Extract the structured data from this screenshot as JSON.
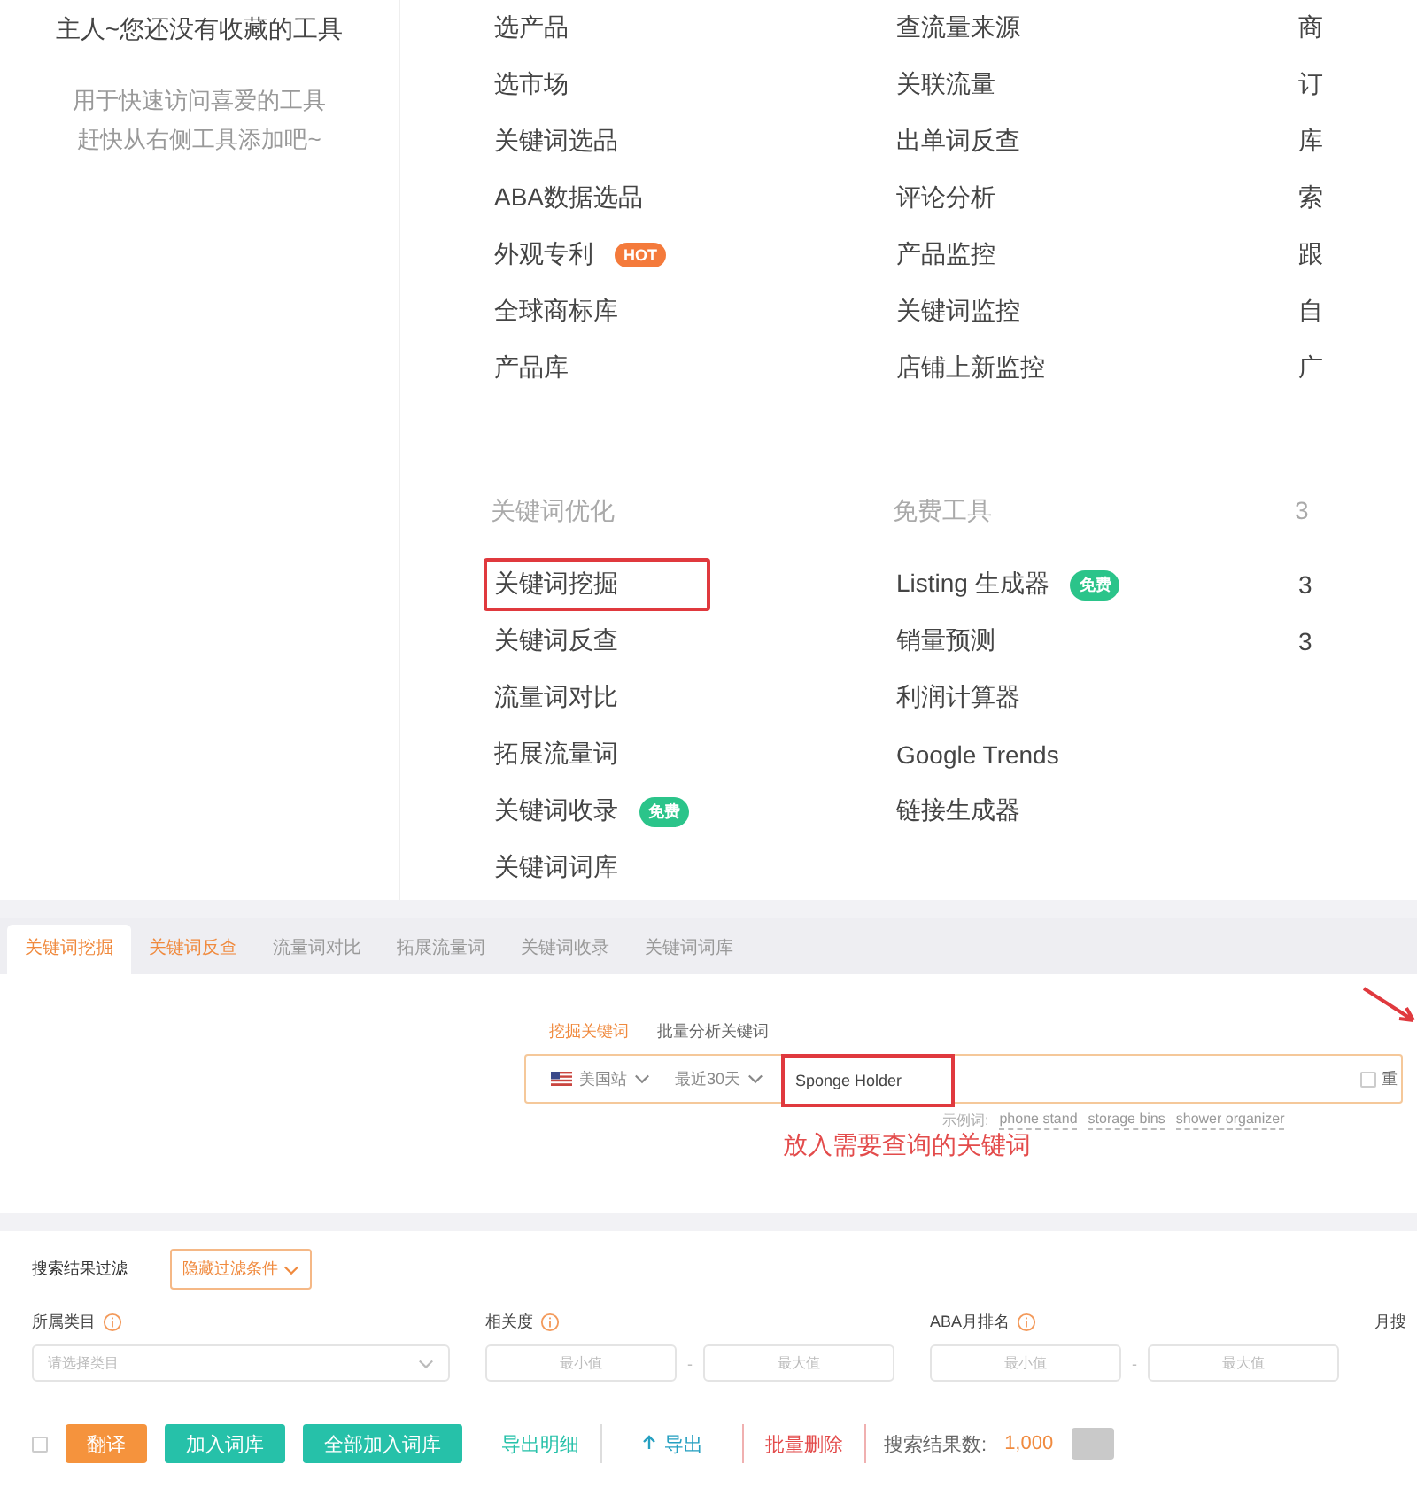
{
  "favorites": {
    "title": "主人~您还没有收藏的工具",
    "hint_lines": [
      "用于快速访问喜爱的工具",
      "赶快从右侧工具添加吧~"
    ]
  },
  "menu": {
    "columns": [
      {
        "groups": [
          {
            "items": [
              {
                "label": "选产品",
                "boxed": false
              },
              {
                "label": "选市场",
                "boxed": false
              },
              {
                "label": "关键词选品",
                "boxed": false
              },
              {
                "label": "ABA数据选品",
                "boxed": false
              },
              {
                "label": "外观专利",
                "boxed": false,
                "badge": {
                  "text": "HOT",
                  "kind": "hot"
                }
              },
              {
                "label": "全球商标库",
                "boxed": false
              },
              {
                "label": "产品库",
                "boxed": false
              }
            ]
          },
          {
            "header": "关键词优化",
            "items": [
              {
                "label": "关键词挖掘",
                "boxed": true
              },
              {
                "label": "关键词反查",
                "boxed": false
              },
              {
                "label": "流量词对比",
                "boxed": false
              },
              {
                "label": "拓展流量词",
                "boxed": false
              },
              {
                "label": "关键词收录",
                "boxed": false,
                "badge": {
                  "text": "免费",
                  "kind": "free"
                }
              },
              {
                "label": "关键词词库",
                "boxed": false
              }
            ]
          }
        ]
      },
      {
        "groups": [
          {
            "items": [
              {
                "label": "查流量来源",
                "boxed": false
              },
              {
                "label": "关联流量",
                "boxed": false
              },
              {
                "label": "出单词反查",
                "boxed": false
              },
              {
                "label": "评论分析",
                "boxed": false
              },
              {
                "label": "产品监控",
                "boxed": false
              },
              {
                "label": "关键词监控",
                "boxed": false
              },
              {
                "label": "店铺上新监控",
                "boxed": false
              }
            ]
          },
          {
            "header": "免费工具",
            "items": [
              {
                "label": "Listing 生成器",
                "boxed": false,
                "badge": {
                  "text": "免费",
                  "kind": "free"
                }
              },
              {
                "label": "销量预测",
                "boxed": false
              },
              {
                "label": "利润计算器",
                "boxed": false
              },
              {
                "label": "Google Trends",
                "boxed": false
              },
              {
                "label": "链接生成器",
                "boxed": false
              }
            ]
          }
        ]
      },
      {
        "groups": [
          {
            "items": [
              {
                "label": "商",
                "boxed": false
              },
              {
                "label": "订",
                "boxed": false
              },
              {
                "label": "库",
                "boxed": false
              },
              {
                "label": "索",
                "boxed": false
              },
              {
                "label": "跟",
                "boxed": false
              },
              {
                "label": "自",
                "boxed": false
              },
              {
                "label": "广",
                "boxed": false
              }
            ]
          },
          {
            "header": "3",
            "items": [
              {
                "label": "3",
                "boxed": false
              },
              {
                "label": "3",
                "boxed": false
              }
            ]
          }
        ]
      }
    ]
  },
  "tool_tabs": [
    {
      "label": "关键词挖掘",
      "selected": true
    },
    {
      "label": "关键词反查",
      "selected": false,
      "hover": true
    },
    {
      "label": "流量词对比",
      "selected": false,
      "hover": false
    },
    {
      "label": "拓展流量词",
      "selected": false,
      "hover": false
    },
    {
      "label": "关键词收录",
      "selected": false,
      "hover": false
    },
    {
      "label": "关键词词库",
      "selected": false,
      "hover": false
    }
  ],
  "search": {
    "modes": [
      {
        "label": "挖掘关键词",
        "selected": true
      },
      {
        "label": "批量分析关键词",
        "selected": false
      }
    ],
    "site": "美国站",
    "period": "最近30天",
    "value": "Sponge Holder",
    "boxed": true,
    "checkbox": {
      "label": "重",
      "checked": false
    },
    "examples_label": "示例词:",
    "examples": [
      "phone stand",
      "storage bins",
      "shower organizer"
    ],
    "note": "放入需要查询的关键词"
  },
  "filters": {
    "title": "搜索结果过滤",
    "toggle": "隐藏过滤条件",
    "fields": [
      {
        "kind": "select",
        "label": "所属类目",
        "placeholder": "请选择类目"
      },
      {
        "kind": "range",
        "label": "相关度",
        "min_placeholder": "最小值",
        "separator": "-",
        "max_placeholder": "最大值"
      },
      {
        "kind": "range",
        "label": "ABA月排名",
        "min_placeholder": "最小值",
        "separator": "-",
        "max_placeholder": "最大值"
      },
      {
        "kind": "cut",
        "label": "月搜"
      }
    ]
  },
  "toolbar": {
    "checkbox": {
      "checked": false
    },
    "buttons": [
      {
        "label": "翻译",
        "kind": "orange"
      },
      {
        "label": "加入词库",
        "kind": "teal"
      },
      {
        "label": "全部加入词库",
        "kind": "teal"
      },
      {
        "label": "导出明细",
        "kind": "link"
      },
      {
        "label": "导出",
        "kind": "export"
      },
      {
        "label": "批量删除",
        "kind": "danger"
      }
    ],
    "result_label": "搜索结果数:",
    "result_count": "1,000"
  }
}
